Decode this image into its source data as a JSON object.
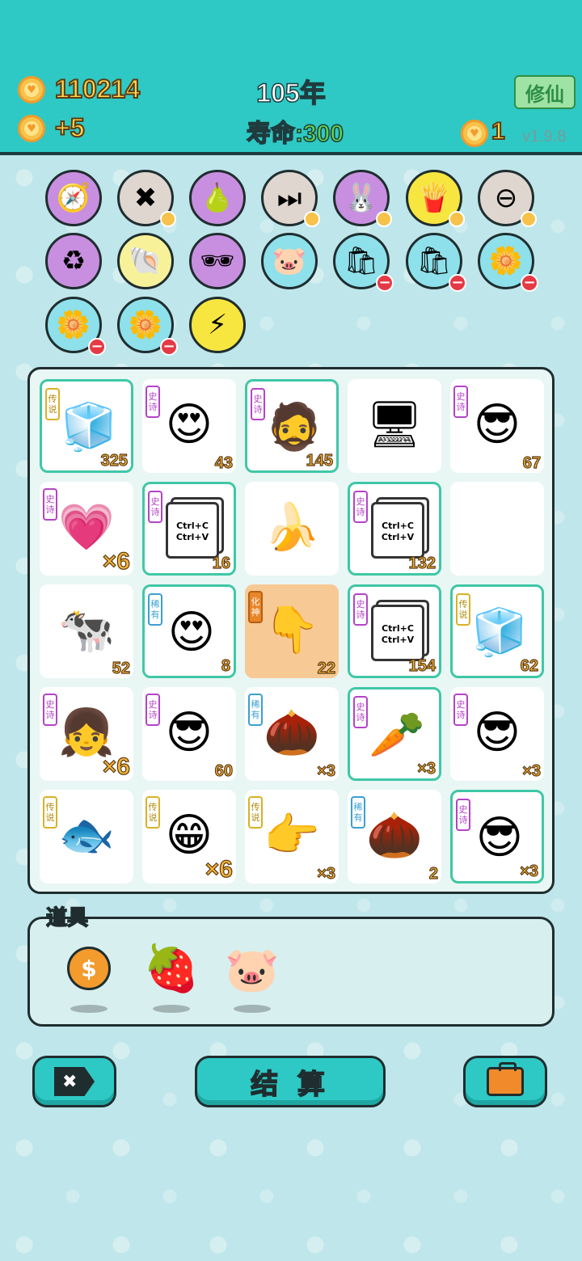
{
  "header": {
    "coins": "110214",
    "coin_rate": "+5",
    "year": "105年",
    "lifespan_label": "寿命:",
    "lifespan_value": "300",
    "cultivate_button": "修仙",
    "extra_coins": "1",
    "version": "v1.9.8"
  },
  "round_icons": [
    {
      "name": "compass-icon",
      "glyph": "🧭",
      "bg": "#c88fe0"
    },
    {
      "name": "delete-tag-icon",
      "glyph": "✖",
      "bg": "#ded6cf"
    },
    {
      "name": "pomelo-icon",
      "glyph": "🍐",
      "bg": "#c88fe0"
    },
    {
      "name": "skip-icon",
      "glyph": "⏭",
      "bg": "#ded6cf"
    },
    {
      "name": "rabbit-icon",
      "glyph": "🐰",
      "bg": "#c88fe0"
    },
    {
      "name": "fries-icon",
      "glyph": "🍟",
      "bg": "#f7e640"
    },
    {
      "name": "minus-circle-icon",
      "glyph": "⊖",
      "bg": "#ded6cf"
    },
    {
      "name": "recycle-icon",
      "glyph": "♻",
      "bg": "#c88fe0"
    },
    {
      "name": "shell-icon",
      "glyph": "🐚",
      "bg": "#f7f29a"
    },
    {
      "name": "sunglasses-icon",
      "glyph": "🕶",
      "bg": "#c88fe0"
    },
    {
      "name": "piggy-bank-icon",
      "glyph": "🐷",
      "bg": "#8ee0ea"
    },
    {
      "name": "seed-bag-icon",
      "glyph": "🛍",
      "bg": "#8ee0ea"
    },
    {
      "name": "seed-bag-icon-2",
      "glyph": "🛍",
      "bg": "#8ee0ea"
    },
    {
      "name": "flower-pot-icon",
      "glyph": "🌼",
      "bg": "#8ee0ea"
    },
    {
      "name": "flower-pot-icon-2",
      "glyph": "🌼",
      "bg": "#8ee0ea"
    },
    {
      "name": "flower-pot-icon-3",
      "glyph": "🌼",
      "bg": "#8ee0ea"
    },
    {
      "name": "lightning-icon",
      "glyph": "⚡",
      "bg": "#f7e640"
    }
  ],
  "board": [
    {
      "tag": "传说",
      "kind": "leg",
      "icon": "fridge-icon",
      "glyph": "🧊",
      "num": "325",
      "hl": true
    },
    {
      "tag": "史诗",
      "kind": "epic",
      "icon": "green-hat-heart-eyes-icon",
      "glyph": "😍",
      "num": "43",
      "hl": false
    },
    {
      "tag": "史诗",
      "kind": "epic",
      "icon": "bearded-man-icon",
      "glyph": "🧔",
      "num": "145",
      "hl": true
    },
    {
      "tag": "",
      "kind": "",
      "icon": "computer-icon",
      "glyph": "🖥",
      "num": "",
      "hl": false
    },
    {
      "tag": "史诗",
      "kind": "epic",
      "icon": "green-hat-sunglasses-icon",
      "glyph": "😎",
      "num": "67",
      "hl": false
    },
    {
      "tag": "史诗",
      "kind": "epic",
      "icon": "heart-girl-icon",
      "glyph": "💗",
      "num": "×6",
      "big": true,
      "hl": false
    },
    {
      "tag": "史诗",
      "kind": "epic",
      "icon": "ctrl-cv-icon",
      "ctrl": true,
      "num": "16",
      "hl": true
    },
    {
      "tag": "",
      "kind": "",
      "icon": "banana-icon",
      "glyph": "🍌",
      "num": "",
      "hl": false
    },
    {
      "tag": "史诗",
      "kind": "epic",
      "icon": "ctrl-cv-icon",
      "ctrl": true,
      "num": "132",
      "hl": true
    },
    {
      "tag": "",
      "kind": "",
      "icon": "empty-slot",
      "glyph": "",
      "num": "",
      "hl": false
    },
    {
      "tag": "",
      "kind": "",
      "icon": "cow-icon",
      "glyph": "🐄",
      "num": "52",
      "hl": false
    },
    {
      "tag": "稀有",
      "kind": "rare",
      "icon": "bald-heart-eyes-icon",
      "glyph": "😍",
      "num": "8",
      "hl": true
    },
    {
      "tag": "化神",
      "kind": "god",
      "icon": "pointing-hand-icon",
      "glyph": "👇",
      "num": "22",
      "hl": false,
      "orange": true
    },
    {
      "tag": "史诗",
      "kind": "epic",
      "icon": "ctrl-cv-icon",
      "ctrl": true,
      "num": "154",
      "hl": true
    },
    {
      "tag": "传说",
      "kind": "leg",
      "icon": "fridge-sparkle-icon",
      "glyph": "🧊",
      "num": "62",
      "hl": true
    },
    {
      "tag": "史诗",
      "kind": "epic",
      "icon": "braided-girl-icon",
      "glyph": "👧",
      "num": "×6",
      "big": true,
      "hl": false
    },
    {
      "tag": "史诗",
      "kind": "epic",
      "icon": "green-hat-sunglasses-icon",
      "glyph": "😎",
      "num": "60",
      "hl": false
    },
    {
      "tag": "稀有",
      "kind": "rare",
      "icon": "walnut-icon",
      "glyph": "🌰",
      "num": "×3",
      "hl": false
    },
    {
      "tag": "史诗",
      "kind": "epic",
      "icon": "carrot-icon",
      "glyph": "🥕",
      "num": "×3",
      "hl": true
    },
    {
      "tag": "史诗",
      "kind": "epic",
      "icon": "green-hat-sunglasses-icon",
      "glyph": "😎",
      "num": "×3",
      "hl": false
    },
    {
      "tag": "传说",
      "kind": "leg",
      "icon": "koi-fish-icon",
      "glyph": "🐟",
      "num": "",
      "hl": false
    },
    {
      "tag": "传说",
      "kind": "leg",
      "icon": "bald-grin-icon",
      "glyph": "😁",
      "num": "×6",
      "big": true,
      "hl": false
    },
    {
      "tag": "传说",
      "kind": "leg",
      "icon": "pointing-right-hand-icon",
      "glyph": "👉",
      "num": "×3",
      "hl": false
    },
    {
      "tag": "稀有",
      "kind": "rare",
      "icon": "walnut-icon",
      "glyph": "🌰",
      "num": "2",
      "hl": false
    },
    {
      "tag": "史诗",
      "kind": "epic",
      "icon": "green-hat-sunglasses-icon",
      "glyph": "😎",
      "num": "×3",
      "hl": true
    }
  ],
  "items": {
    "label": "道具",
    "list": [
      {
        "name": "dollar-coin-icon",
        "glyph": "$"
      },
      {
        "name": "strawberry-icon",
        "glyph": "🍓"
      },
      {
        "name": "piggy-bank-icon",
        "glyph": "🐷"
      }
    ]
  },
  "buttons": {
    "settle": "结 算"
  },
  "colors": {
    "header": "#2ec9c4",
    "coin_text": "#ffd64a",
    "life_text": "#5cd34a",
    "highlight": "#3fc7a6"
  }
}
